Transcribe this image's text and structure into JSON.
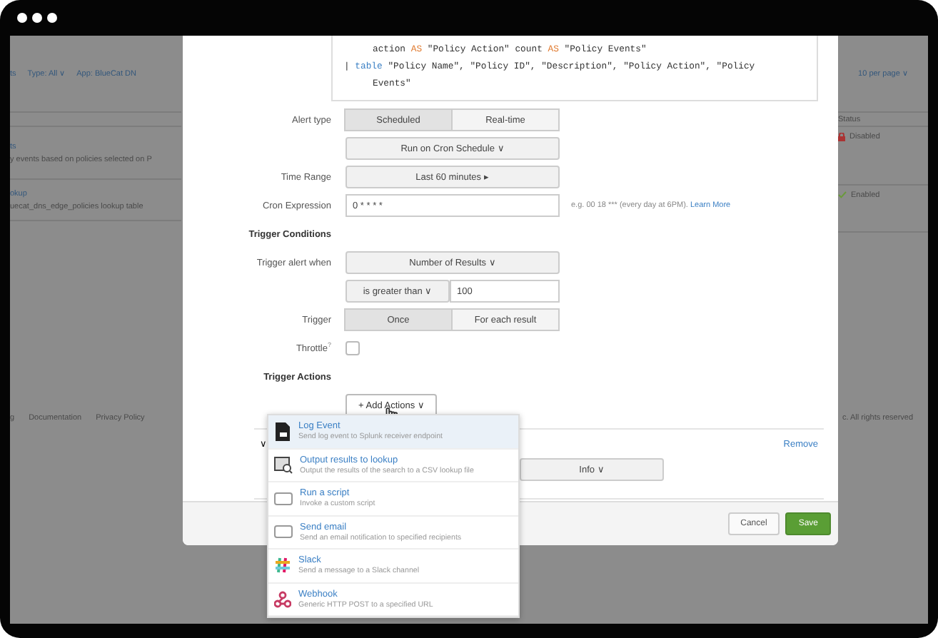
{
  "background_page": {
    "title": "ts",
    "filters": [
      "Type: All ∨",
      "App: BlueCat DN"
    ],
    "per_page": "10 per page ∨",
    "column_heading": "Status",
    "rows": [
      {
        "name": "ts",
        "description": "y events based on policies selected on P",
        "status": "Disabled",
        "enabled": false
      },
      {
        "name": "okup",
        "description": "uecat_dns_edge_policies lookup table",
        "status": "Enabled",
        "enabled": true
      }
    ],
    "footer_links": [
      "g",
      "Documentation",
      "Privacy Policy"
    ],
    "copyright": "c. All rights reserved"
  },
  "modal": {
    "search_code": [
      {
        "indent": true,
        "tokens": [
          {
            "kind": "plain",
            "text": "action "
          },
          {
            "kind": "keyword",
            "text": "AS"
          },
          {
            "kind": "plain",
            "text": " \"Policy Action\" count "
          },
          {
            "kind": "keyword",
            "text": "AS"
          },
          {
            "kind": "plain",
            "text": " \"Policy Events\""
          }
        ]
      },
      {
        "indent": false,
        "tokens": [
          {
            "kind": "plain",
            "text": "| "
          },
          {
            "kind": "command",
            "text": "table"
          },
          {
            "kind": "plain",
            "text": " \"Policy Name\", \"Policy ID\", \"Description\", \"Policy Action\", \"Policy"
          }
        ]
      },
      {
        "indent": true,
        "tokens": [
          {
            "kind": "plain",
            "text": "Events\""
          }
        ]
      }
    ],
    "form": [
      {
        "kind": "segmented",
        "label": "Alert type",
        "options": [
          {
            "label": "Scheduled",
            "selected": true
          },
          {
            "label": "Real-time",
            "selected": false
          }
        ]
      },
      {
        "kind": "dropdown",
        "value": "Run on Cron Schedule ∨"
      },
      {
        "kind": "dropdown",
        "label": "Time Range",
        "value": "Last 60 minutes ▸"
      },
      {
        "kind": "input",
        "label": "Cron Expression",
        "value": "0 * * * *",
        "hint": "e.g. 00 18 *** (every day at 6PM).",
        "link": "Learn More"
      },
      {
        "kind": "heading",
        "text": "Trigger Conditions"
      },
      {
        "kind": "dropdown",
        "label": "Trigger alert when",
        "value": "Number of Results ∨"
      },
      {
        "kind": "compare",
        "operator": "is greater than ∨",
        "value": "100"
      },
      {
        "kind": "segmented",
        "label": "Trigger",
        "options": [
          {
            "label": "Once",
            "selected": true
          },
          {
            "label": "For each result",
            "selected": false
          }
        ]
      },
      {
        "kind": "checkbox",
        "label": "Throttle",
        "help": "?",
        "checked": false
      },
      {
        "kind": "heading",
        "text": "Trigger Actions"
      },
      {
        "kind": "button",
        "text": "+ Add Actions ∨"
      }
    ],
    "action": {
      "toggle": "∨",
      "remove": "Remove",
      "severity": "Info ∨"
    },
    "buttons": [
      {
        "label": "Cancel",
        "kind": "default"
      },
      {
        "label": "Save",
        "kind": "primary"
      }
    ]
  },
  "actions_menu": [
    {
      "kind": "log",
      "title": "Log Event",
      "description": "Send log event to Splunk receiver endpoint",
      "selected": true
    },
    {
      "kind": "lookup",
      "title": "Output results to lookup",
      "description": "Output the results of the search to a CSV lookup file",
      "selected": false
    },
    {
      "kind": "script",
      "title": "Run a script",
      "description": "Invoke a custom script",
      "selected": false
    },
    {
      "kind": "email",
      "title": "Send email",
      "description": "Send an email notification to specified recipients",
      "selected": false
    },
    {
      "kind": "slack",
      "title": "Slack",
      "description": "Send a message to a Slack channel",
      "selected": false
    },
    {
      "kind": "webhook",
      "title": "Webhook",
      "description": "Generic HTTP POST to a specified URL",
      "selected": false
    }
  ]
}
